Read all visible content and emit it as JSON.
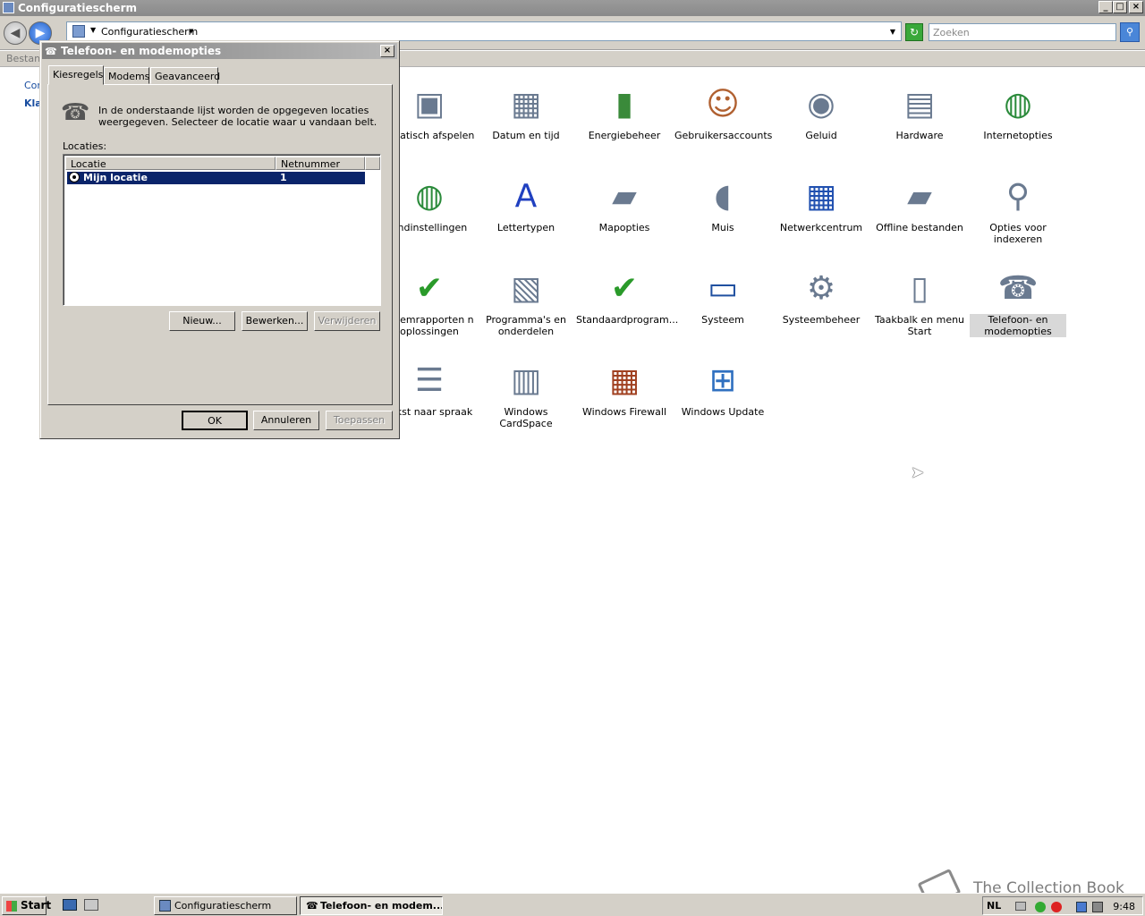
{
  "window": {
    "title": "Configuratiescherm"
  },
  "address": {
    "path": "Configuratiescherm",
    "search_placeholder": "Zoeken"
  },
  "menubar": {
    "label": "Bestand"
  },
  "leftpane": {
    "link1": "Cor",
    "link2": "Kla"
  },
  "items": [
    {
      "label": "omatisch afspelen",
      "icon": "autoplay-icon"
    },
    {
      "label": "Datum en tijd",
      "icon": "calendar-clock-icon"
    },
    {
      "label": "Energiebeheer",
      "icon": "battery-plug-icon"
    },
    {
      "label": "Gebruikersaccounts",
      "icon": "users-icon"
    },
    {
      "label": "Geluid",
      "icon": "speaker-icon"
    },
    {
      "label": "Hardware",
      "icon": "hardware-icon"
    },
    {
      "label": "Internetopties",
      "icon": "globe-icon"
    },
    {
      "label": "andinstellingen",
      "icon": "globe-clock-icon"
    },
    {
      "label": "Lettertypen",
      "icon": "font-folder-icon"
    },
    {
      "label": "Mapopties",
      "icon": "folder-options-icon"
    },
    {
      "label": "Muis",
      "icon": "mouse-icon"
    },
    {
      "label": "Netwerkcentrum",
      "icon": "network-icon"
    },
    {
      "label": "Offline bestanden",
      "icon": "offline-folder-icon"
    },
    {
      "label": "Opties voor indexeren",
      "icon": "index-icon"
    },
    {
      "label": "bleemrapporten n oplossingen",
      "icon": "problem-reports-icon"
    },
    {
      "label": "Programma's en onderdelen",
      "icon": "programs-icon"
    },
    {
      "label": "Standaardprogram...",
      "icon": "default-programs-icon"
    },
    {
      "label": "Systeem",
      "icon": "system-monitor-icon"
    },
    {
      "label": "Systeembeheer",
      "icon": "admin-tools-icon"
    },
    {
      "label": "Taakbalk en menu Start",
      "icon": "taskbar-icon"
    },
    {
      "label": "Telefoon- en modemopties",
      "icon": "phone-icon"
    },
    {
      "label": "tekst naar spraak",
      "icon": "speech-icon"
    },
    {
      "label": "Windows CardSpace",
      "icon": "cardspace-icon"
    },
    {
      "label": "Windows Firewall",
      "icon": "firewall-icon"
    },
    {
      "label": "Windows Update",
      "icon": "windows-update-icon"
    }
  ],
  "dialog": {
    "title": "Telefoon- en modemopties",
    "tabs": [
      "Kiesregels",
      "Modems",
      "Geavanceerd"
    ],
    "info": "In de onderstaande lijst worden de opgegeven locaties weergegeven. Selecteer de locatie waar u vandaan belt.",
    "locations_label": "Locaties:",
    "col_location": "Locatie",
    "col_areacode": "Netnummer",
    "row": {
      "location": "Mijn locatie",
      "areacode": "1"
    },
    "btn_new": "Nieuw...",
    "btn_edit": "Bewerken...",
    "btn_delete": "Verwijderen",
    "btn_ok": "OK",
    "btn_cancel": "Annuleren",
    "btn_apply": "Toepassen"
  },
  "taskbar": {
    "start": "Start",
    "task1": "Configuratiescherm",
    "task2": "Telefoon- en modem...",
    "lang": "NL",
    "clock": "9:48"
  },
  "watermark": "The Collection Book"
}
